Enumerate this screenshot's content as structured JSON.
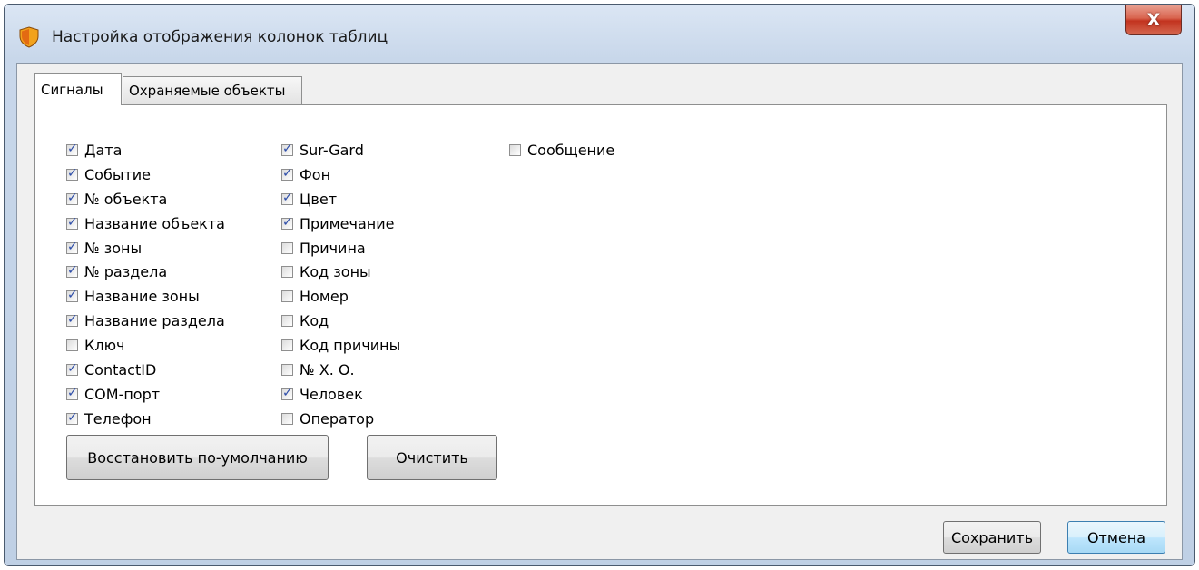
{
  "window": {
    "title": "Настройка отображения колонок таблиц",
    "close_label": "X"
  },
  "tabs": [
    {
      "label": "Сигналы",
      "active": true
    },
    {
      "label": "Охраняемые объекты",
      "active": false
    }
  ],
  "columns": [
    [
      {
        "label": "Дата",
        "checked": true
      },
      {
        "label": "Событие",
        "checked": true
      },
      {
        "label": "№ объекта",
        "checked": true
      },
      {
        "label": "Название объекта",
        "checked": true
      },
      {
        "label": "№ зоны",
        "checked": true
      },
      {
        "label": "№ раздела",
        "checked": true
      },
      {
        "label": "Название зоны",
        "checked": true
      },
      {
        "label": "Название раздела",
        "checked": true
      },
      {
        "label": "Ключ",
        "checked": false
      },
      {
        "label": "ContactID",
        "checked": true
      },
      {
        "label": "COM-порт",
        "checked": true
      },
      {
        "label": "Телефон",
        "checked": true
      }
    ],
    [
      {
        "label": "Sur-Gard",
        "checked": true
      },
      {
        "label": "Фон",
        "checked": true
      },
      {
        "label": "Цвет",
        "checked": true
      },
      {
        "label": "Примечание",
        "checked": true
      },
      {
        "label": "Причина",
        "checked": false
      },
      {
        "label": "Код зоны",
        "checked": false
      },
      {
        "label": "Номер",
        "checked": false
      },
      {
        "label": "Код",
        "checked": false
      },
      {
        "label": "Код причины",
        "checked": false
      },
      {
        "label": "№ Х. О.",
        "checked": false
      },
      {
        "label": "Человек",
        "checked": true
      },
      {
        "label": "Оператор",
        "checked": false
      }
    ],
    [
      {
        "label": "Сообщение",
        "checked": false
      }
    ]
  ],
  "buttons": {
    "restore_defaults": "Восстановить по-умолчанию",
    "clear": "Очистить",
    "save": "Сохранить",
    "cancel": "Отмена"
  }
}
